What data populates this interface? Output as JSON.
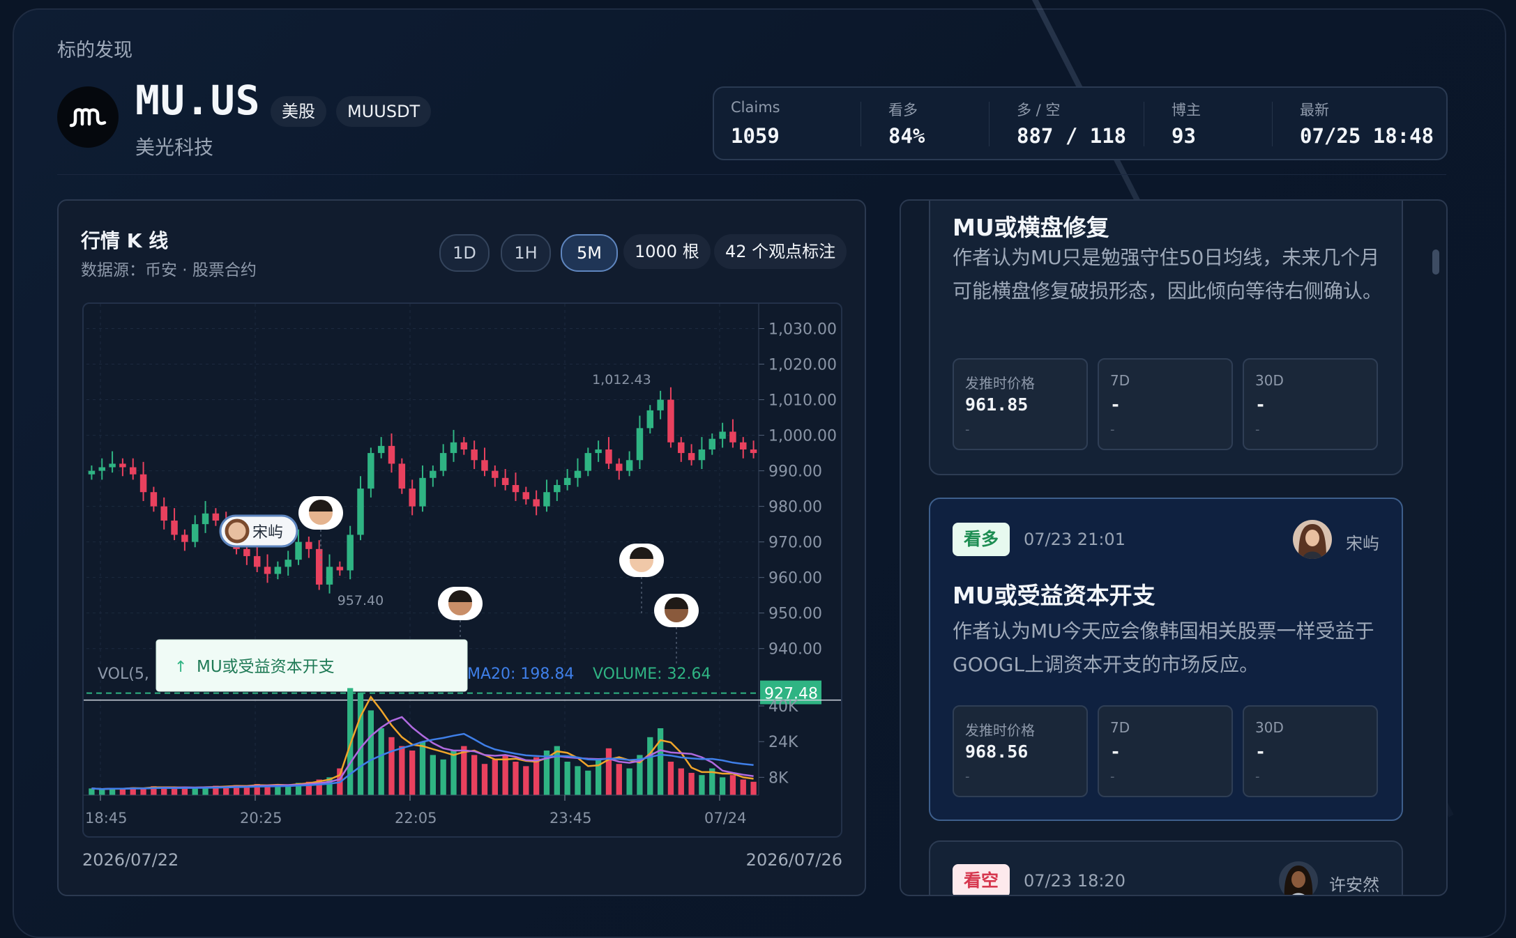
{
  "header": {
    "eyebrow": "标的发现",
    "ticker": "MU.US",
    "tags": [
      "美股",
      "MUUSDT"
    ],
    "company": "美光科技"
  },
  "stats": [
    {
      "label": "Claims",
      "value": "1059"
    },
    {
      "label": "看多",
      "value": "84%"
    },
    {
      "label": "多 / 空",
      "value": "887 / 118"
    },
    {
      "label": "博主",
      "value": "93"
    },
    {
      "label": "最新",
      "value": "07/25 18:48"
    }
  ],
  "chart_panel": {
    "title": "行情 K 线",
    "subtitle": "数据源：币安 · 股票合约",
    "intervals": [
      "1D",
      "1H",
      "5M"
    ],
    "active_interval": "5M",
    "bar_count": "1000 根",
    "annotation_count": "42 个观点标注",
    "date_start": "2026/07/22",
    "date_end": "2026/07/26",
    "high_label": "1,012.43",
    "low_label": "957.40",
    "last_price": "927.48",
    "marker_author": "宋屿",
    "tooltip": "MU或受益资本开支",
    "vol_prefix": "VOL(5,",
    "ma20_label": "MA20: 198.84",
    "volume_label": "VOLUME: 32.64"
  },
  "chart_data": {
    "type": "candlestick",
    "x_ticks": [
      "18:45",
      "20:25",
      "22:05",
      "23:45",
      "07/24"
    ],
    "price_ticks": [
      "1,030.00",
      "1,020.00",
      "1,010.00",
      "1,000.00",
      "990.00",
      "980.00",
      "970.00",
      "960.00",
      "950.00",
      "940.00"
    ],
    "price_range": [
      937,
      1035
    ],
    "volume_ticks": [
      "40K",
      "24K",
      "8K"
    ],
    "volume_range": [
      0,
      50000
    ],
    "close": [
      990,
      991,
      992,
      991,
      989,
      984,
      980,
      976,
      972,
      970,
      975,
      978,
      976,
      972,
      968,
      966,
      963,
      961,
      963,
      965,
      970,
      968,
      958,
      963,
      962,
      972,
      985,
      995,
      997,
      992,
      985,
      980,
      988,
      990,
      995,
      998,
      996,
      993,
      990,
      988,
      986,
      984,
      982,
      980,
      984,
      986,
      988,
      990,
      995,
      996,
      992,
      990,
      993,
      1002,
      1007,
      1010,
      998,
      995,
      993,
      996,
      999,
      1001,
      998,
      996,
      995
    ],
    "volume": [
      3000,
      2500,
      3200,
      2800,
      3500,
      3000,
      4000,
      3500,
      3000,
      3800,
      3300,
      3600,
      4200,
      3800,
      4500,
      4000,
      5000,
      4200,
      4800,
      4500,
      5500,
      6000,
      7000,
      8000,
      12000,
      48000,
      46000,
      38000,
      30000,
      26000,
      22000,
      20000,
      24000,
      18000,
      16000,
      20000,
      22000,
      18000,
      14000,
      16000,
      18000,
      15000,
      13000,
      17000,
      20000,
      22000,
      15000,
      13000,
      11000,
      16000,
      21000,
      14000,
      12000,
      18000,
      26000,
      30000,
      15000,
      12000,
      10000,
      9000,
      12000,
      8000,
      9000,
      7000,
      6000
    ]
  },
  "posts": [
    {
      "title": "MU或横盘修复",
      "body": "作者认为MU只是勉强守住50日均线，未来几个月可能横盘修复破损形态，因此倾向等待右侧确认。",
      "boxes": [
        {
          "label": "发推时价格",
          "value": "961.85",
          "sub": "-"
        },
        {
          "label": "7D",
          "value": "-",
          "sub": "-"
        },
        {
          "label": "30D",
          "value": "-",
          "sub": "-"
        }
      ]
    },
    {
      "badge": "看多",
      "time": "07/23 21:01",
      "author": "宋屿",
      "title": "MU或受益资本开支",
      "body": "作者认为MU今天应会像韩国相关股票一样受益于GOOGL上调资本开支的市场反应。",
      "boxes": [
        {
          "label": "发推时价格",
          "value": "968.56",
          "sub": "-"
        },
        {
          "label": "7D",
          "value": "-",
          "sub": "-"
        },
        {
          "label": "30D",
          "value": "-",
          "sub": "-"
        }
      ]
    },
    {
      "badge": "看空",
      "time": "07/23 18:20",
      "author": "许安然"
    }
  ],
  "colors": {
    "up": "#2fb483",
    "down": "#e9415e",
    "ma_orange": "#f0a52a",
    "ma_purple": "#b06ae0",
    "ma_blue": "#3f7fe8",
    "accent": "#5f86bf"
  }
}
